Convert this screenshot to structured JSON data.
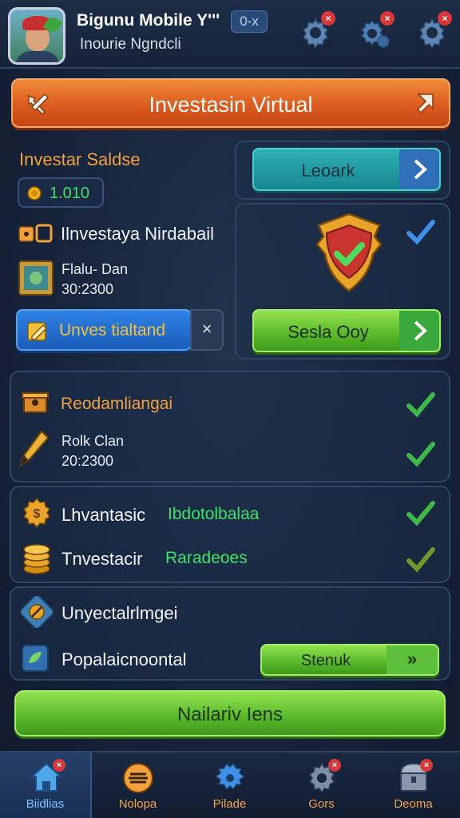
{
  "header": {
    "title": "Bigunu Mobile Y'''",
    "subtitle": "Inourie Ngndcli",
    "badge": "0-x",
    "icons": [
      "gear-icon",
      "settings-gear-icon",
      "gear-icon"
    ],
    "notif_badge": "×"
  },
  "banner": {
    "title": "Investasin Virtual",
    "left_icon": "tools-icon",
    "right_icon": "arrow-icon"
  },
  "investor": {
    "label": "Investar Saldse",
    "balance": "1.010",
    "line1": "Ilnvestaya Nirdabail",
    "item_title": "Flalu- Dan",
    "item_value": "30:2300",
    "input_button": "Unves tialtand",
    "close_symbol": "×"
  },
  "actions": {
    "top_button": "Leoark",
    "shield": "shield-check-icon",
    "bottom_button": "Sesla Ooy"
  },
  "rewards": {
    "label": "Reodamliangai",
    "item_title": "Rolk Clan",
    "item_value": "20:2300"
  },
  "stats": {
    "row1_label": "Lhvantasic",
    "row1_value": "Ibdotolbalaa",
    "row2_label": "Tnvestacir",
    "row2_value": "Raradeoes"
  },
  "extra": {
    "row1_label": "Unyectalrlmgei",
    "row2_label": "Popalaicnoontal",
    "button": "Stenuk",
    "button_arrows": "»"
  },
  "cta": {
    "label": "Nailariv Iens"
  },
  "bottom_nav": [
    {
      "label": "Biidlias",
      "icon": "home-icon"
    },
    {
      "label": "Nolopa",
      "icon": "coin-icon"
    },
    {
      "label": "Pilade",
      "icon": "puzzle-gear-icon"
    },
    {
      "label": "Gors",
      "icon": "gear-icon"
    },
    {
      "label": "Deoma",
      "icon": "chest-icon"
    }
  ],
  "colors": {
    "accent_orange": "#e0661f",
    "accent_green": "#57b829",
    "accent_teal": "#168790",
    "accent_blue": "#1b5dba",
    "check_green": "#3fb84a"
  }
}
